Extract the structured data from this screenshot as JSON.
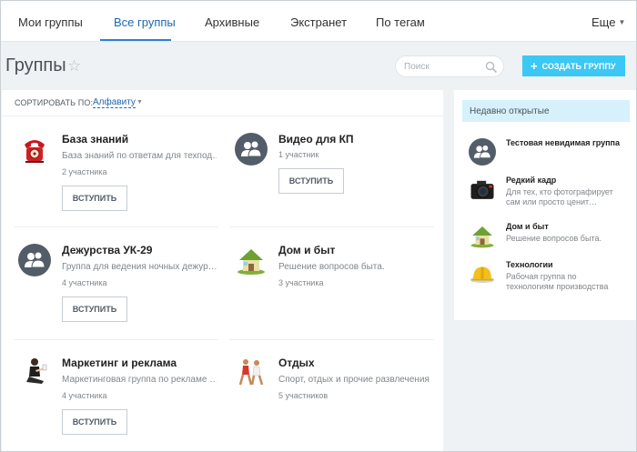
{
  "colors": {
    "accent": "#3bc8f5",
    "link": "#2067b0",
    "panel_header_bg": "#d6f1fb",
    "background": "#eef2f4"
  },
  "nav": {
    "tabs": [
      {
        "label": "Мои группы",
        "active": false
      },
      {
        "label": "Все группы",
        "active": true
      },
      {
        "label": "Архивные",
        "active": false
      },
      {
        "label": "Экстранет",
        "active": false
      },
      {
        "label": "По тегам",
        "active": false
      }
    ],
    "more_label": "Еще",
    "more_icon": "chevron-down-icon"
  },
  "header": {
    "title": "Группы",
    "star_icon": "star-icon",
    "search_placeholder": "Поиск",
    "search_icon": "search-icon",
    "create_button_label": "СОЗДАТЬ ГРУППУ",
    "create_icon": "plus-icon"
  },
  "sort": {
    "label": "СОРТИРОВАТЬ ПО:",
    "value": "Алфавиту"
  },
  "groups": [
    {
      "name": "База знаний",
      "description": "База знаний по ответам для техпод…",
      "members": "2 участника",
      "icon": "red-telephone-icon",
      "join_label": "ВСТУПИТЬ"
    },
    {
      "name": "Видео для КП",
      "description": "",
      "members": "1 участник",
      "icon": "default-group-icon",
      "join_label": "ВСТУПИТЬ"
    },
    {
      "name": "Дежурства УК-29",
      "description": "Группа для ведения ночных дежур…",
      "members": "4 участника",
      "icon": "default-group-icon",
      "join_label": "ВСТУПИТЬ"
    },
    {
      "name": "Дом и быт",
      "description": "Решение вопросов быта.",
      "members": "3 участника",
      "icon": "house-icon",
      "join_label": ""
    },
    {
      "name": "Маркетинг и реклама",
      "description": "Маркетинговая группа по рекламе …",
      "members": "4 участника",
      "icon": "businesswoman-icon",
      "join_label": "ВСТУПИТЬ"
    },
    {
      "name": "Отдых",
      "description": "Спорт, отдых и прочие развлечения",
      "members": "5 участников",
      "icon": "runners-icon",
      "join_label": ""
    }
  ],
  "recent": {
    "title": "Недавно открытые",
    "items": [
      {
        "name": "Тестовая невидимая группа",
        "description": "",
        "icon": "default-group-icon"
      },
      {
        "name": "Редкий кадр",
        "description": "Для тех, кто фотографирует сам или просто ценит…",
        "icon": "camera-icon"
      },
      {
        "name": "Дом и быт",
        "description": "Решение вопросов быта.",
        "icon": "house-icon"
      },
      {
        "name": "Технологии",
        "description": "Рабочая группа по технологиям производства",
        "icon": "hardhat-icon"
      }
    ]
  }
}
